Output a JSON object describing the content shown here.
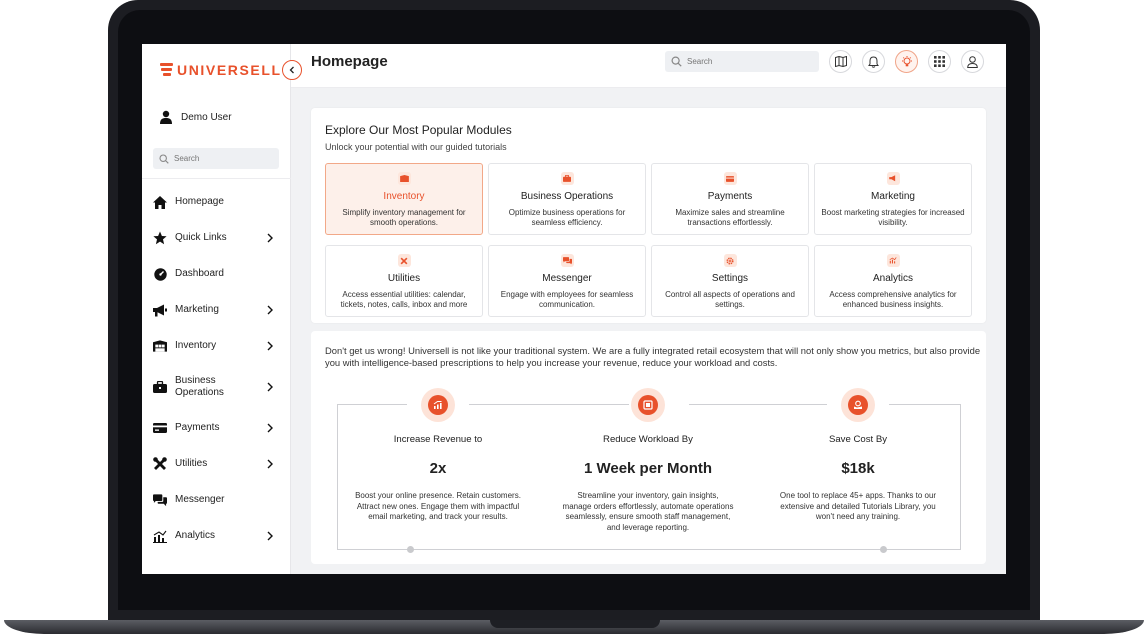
{
  "brand": {
    "name": "UNIVERSELL",
    "accent": "#e8512b"
  },
  "user": {
    "name": "Demo User"
  },
  "sidebar": {
    "search_placeholder": "Search",
    "items": [
      {
        "label": "Homepage",
        "icon": "home-icon",
        "has_submenu": false
      },
      {
        "label": "Quick Links",
        "icon": "star-icon",
        "has_submenu": true
      },
      {
        "label": "Dashboard",
        "icon": "dashboard-icon",
        "has_submenu": false
      },
      {
        "label": "Marketing",
        "icon": "megaphone-icon",
        "has_submenu": true
      },
      {
        "label": "Inventory",
        "icon": "warehouse-icon",
        "has_submenu": true
      },
      {
        "label": "Business Operations",
        "icon": "briefcase-icon",
        "has_submenu": true
      },
      {
        "label": "Payments",
        "icon": "credit-card-icon",
        "has_submenu": true
      },
      {
        "label": "Utilities",
        "icon": "tools-icon",
        "has_submenu": true
      },
      {
        "label": "Messenger",
        "icon": "chat-icon",
        "has_submenu": false
      },
      {
        "label": "Analytics",
        "icon": "chart-icon",
        "has_submenu": true
      }
    ]
  },
  "header": {
    "title": "Homepage",
    "search_placeholder": "Search",
    "buttons": [
      "map-icon",
      "bell-icon",
      "lightbulb-icon",
      "apps-grid-icon",
      "user-icon"
    ]
  },
  "modules": {
    "title": "Explore Our Most Popular Modules",
    "subtitle": "Unlock your potential with our guided tutorials",
    "items": [
      {
        "title": "Inventory",
        "desc": "Simplify inventory management for smooth operations.",
        "active": true
      },
      {
        "title": "Business Operations",
        "desc": "Optimize business operations for seamless efficiency.",
        "active": false
      },
      {
        "title": "Payments",
        "desc": "Maximize sales and streamline transactions effortlessly.",
        "active": false
      },
      {
        "title": "Marketing",
        "desc": "Boost marketing strategies for increased visibility.",
        "active": false
      },
      {
        "title": "Utilities",
        "desc": "Access essential utilities: calendar, tickets, notes, calls, inbox and more",
        "active": false
      },
      {
        "title": "Messenger",
        "desc": "Engage with employees for seamless communication.",
        "active": false
      },
      {
        "title": "Settings",
        "desc": "Control all aspects of operations and settings.",
        "active": false
      },
      {
        "title": "Analytics",
        "desc": "Access comprehensive analytics for enhanced business insights.",
        "active": false
      }
    ]
  },
  "info": {
    "intro": "Don't get us wrong! Universell is not like your traditional system. We are a fully integrated retail ecosystem that will not only show you metrics, but also provide you with intelligence-based prescriptions to help you increase your revenue, reduce your workload and costs.",
    "stats": [
      {
        "label": "Increase Revenue to",
        "value": "2x",
        "desc": "Boost your online presence. Retain customers. Attract new ones. Engage them with impactful email marketing, and track your results."
      },
      {
        "label": "Reduce Workload By",
        "value": "1 Week per Month",
        "desc": "Streamline your inventory, gain insights, manage orders effortlessly, automate operations seamlessly, ensure smooth staff management, and leverage reporting."
      },
      {
        "label": "Save Cost By",
        "value": "$18k",
        "desc": "One tool to replace 45+ apps. Thanks to our extensive and detailed Tutorials Library, you won't need any training."
      }
    ]
  }
}
